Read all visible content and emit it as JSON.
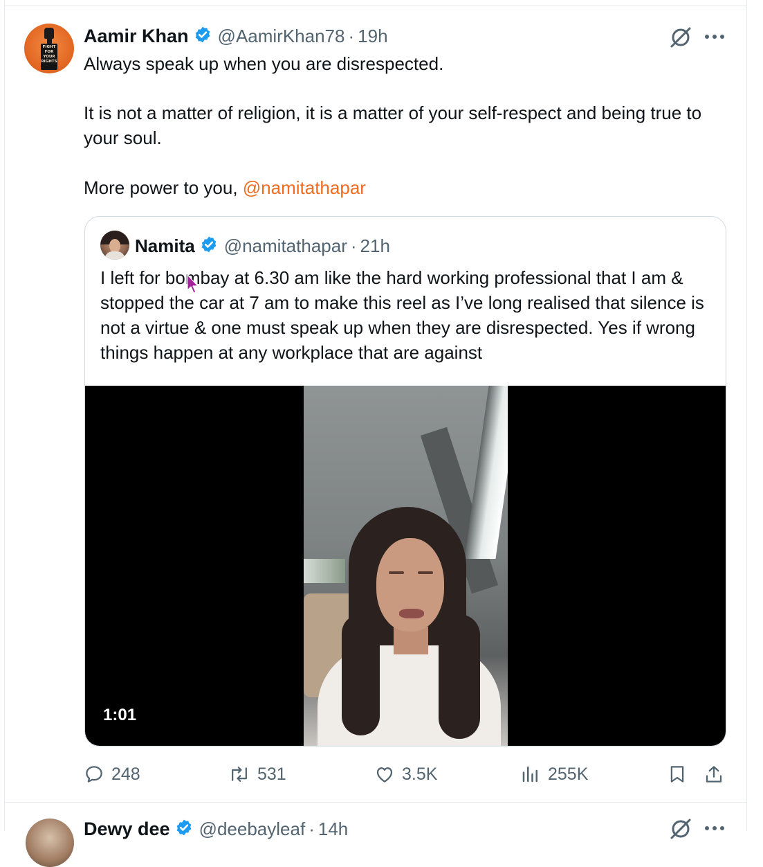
{
  "tweet": {
    "author_name": "Aamir Khan",
    "handle": "@AamirKhan78",
    "separator": "·",
    "time": "19h",
    "avatar_text": "FIGHT\nFOR\nYOUR\nRIGHTS",
    "text_line1": "Always speak up when you are disrespected.",
    "text_para2": "It is not a matter of religion, it is a matter of your self-respect and being true to your soul.",
    "text_para3_prefix": "More power to you, ",
    "mention": "@namitathapar"
  },
  "quote": {
    "author_name": "Namita",
    "handle": "@namitathapar",
    "separator": "·",
    "time": "21h",
    "text": "I left for bombay at 6.30 am like the hard working professional that I am & stopped the car at 7 am to make this reel as I’ve long realised that silence is not a virtue & one must speak up when they are disrespected. Yes if wrong things happen at any workplace that are against",
    "video_duration": "1:01"
  },
  "actions": {
    "replies": "248",
    "reposts": "531",
    "likes": "3.5K",
    "views": "255K"
  },
  "next_tweet": {
    "author_name": "Dewy dee",
    "handle": "@deebayleaf",
    "separator": "·",
    "time": "14h"
  },
  "colors": {
    "verified_badge": "#1d9bf0",
    "mention": "#ef6c21",
    "muted_text": "#536471",
    "border": "#cfd9de"
  },
  "icons": [
    "verified-badge-icon",
    "grok-icon",
    "more-icon",
    "reply-icon",
    "repost-icon",
    "like-icon",
    "views-icon",
    "bookmark-icon",
    "share-icon",
    "cursor-icon"
  ]
}
